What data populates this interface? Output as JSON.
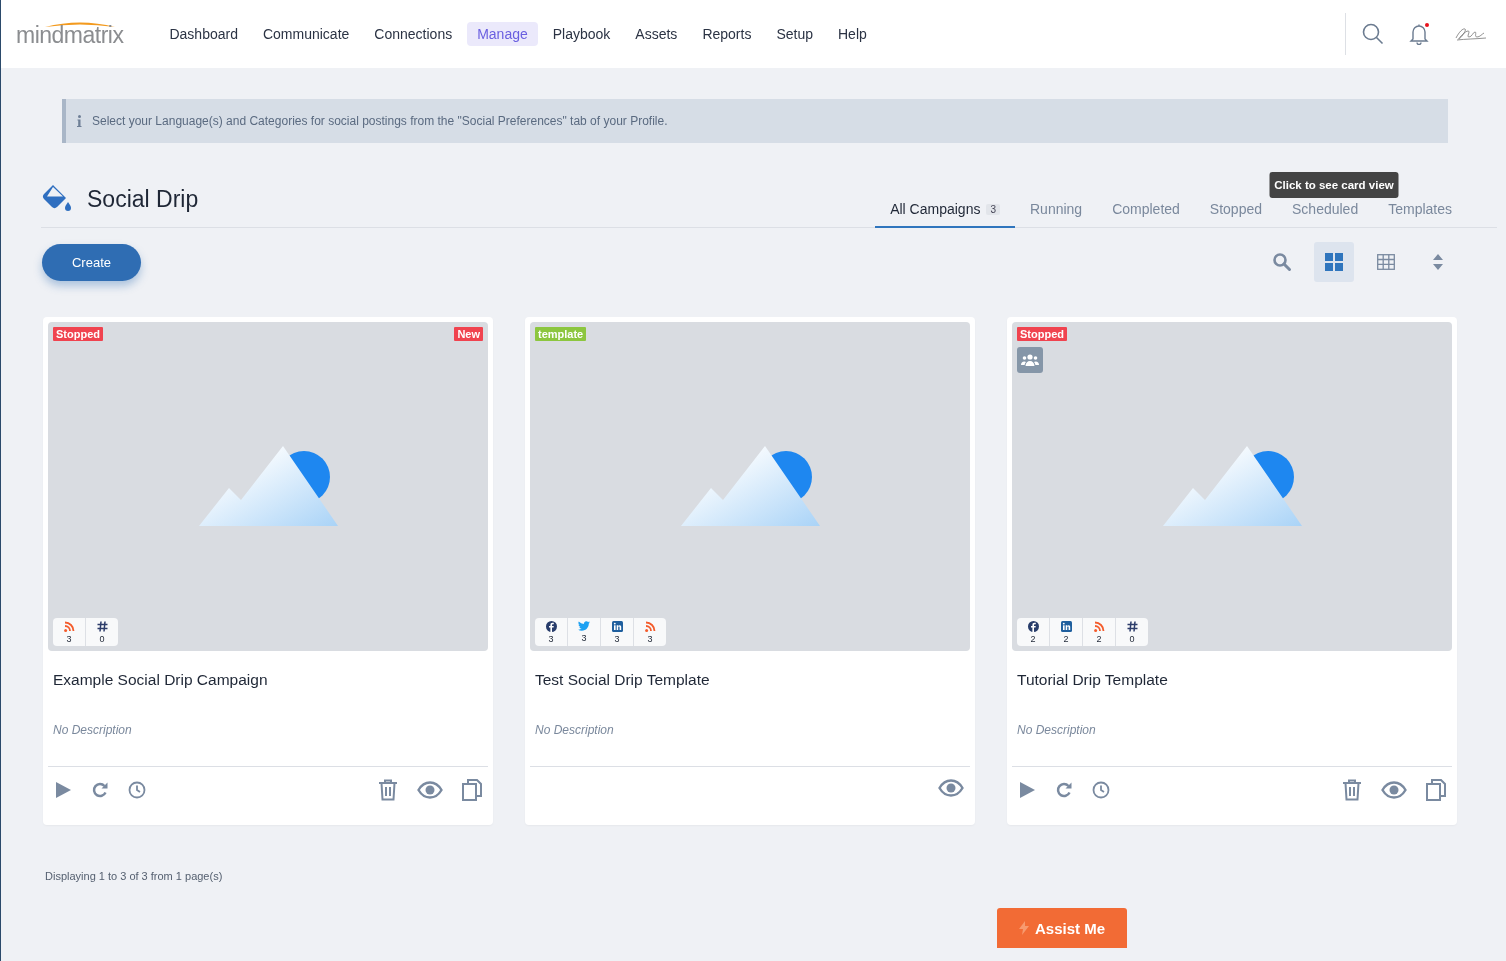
{
  "header": {
    "logo": "mindmatrix",
    "nav": [
      {
        "label": "Dashboard",
        "selected": false
      },
      {
        "label": "Communicate",
        "selected": false
      },
      {
        "label": "Connections",
        "selected": false
      },
      {
        "label": "Manage",
        "selected": true
      },
      {
        "label": "Playbook",
        "selected": false
      },
      {
        "label": "Assets",
        "selected": false
      },
      {
        "label": "Reports",
        "selected": false
      },
      {
        "label": "Setup",
        "selected": false
      },
      {
        "label": "Help",
        "selected": false
      }
    ],
    "notification_dot": true
  },
  "info_banner": "Select your Language(s) and Categories for social postings from the \"Social Preferences\" tab of your Profile.",
  "page_title": "Social Drip",
  "tabs": [
    {
      "label": "All Campaigns",
      "count": "3",
      "selected": true
    },
    {
      "label": "Running",
      "selected": false
    },
    {
      "label": "Completed",
      "selected": false
    },
    {
      "label": "Stopped",
      "selected": false
    },
    {
      "label": "Scheduled",
      "selected": false
    },
    {
      "label": "Templates",
      "selected": false
    }
  ],
  "create_button": "Create",
  "view_tools": [
    {
      "kind": "search",
      "selected": false
    },
    {
      "kind": "grid",
      "selected": true
    },
    {
      "kind": "table",
      "selected": false
    },
    {
      "kind": "sort",
      "selected": false
    }
  ],
  "tooltip": "Click to see card view",
  "cards": [
    {
      "badges": [
        {
          "label": "Stopped",
          "kind": "status",
          "color": "#f0434f"
        },
        {
          "label": "New",
          "kind": "flag",
          "color": "#f0434f"
        }
      ],
      "shared": false,
      "stats": [
        {
          "kind": "rss",
          "count": "3"
        },
        {
          "kind": "hashtag",
          "count": "0"
        }
      ],
      "title": "Example Social Drip Campaign",
      "description": "No Description",
      "actions": [
        {
          "kind": "play"
        },
        {
          "kind": "redo"
        },
        {
          "kind": "clock"
        },
        {
          "kind": "trash"
        },
        {
          "kind": "view"
        },
        {
          "kind": "copy"
        }
      ]
    },
    {
      "badges": [
        {
          "label": "template",
          "kind": "status",
          "color": "#8cc63f"
        }
      ],
      "shared": false,
      "stats": [
        {
          "kind": "facebook",
          "count": "3"
        },
        {
          "kind": "twitter",
          "count": "3"
        },
        {
          "kind": "linkedin",
          "count": "3"
        },
        {
          "kind": "rss",
          "count": "3"
        }
      ],
      "title": "Test Social Drip Template",
      "description": "No Description",
      "actions": [
        {
          "kind": "view"
        }
      ]
    },
    {
      "badges": [
        {
          "label": "Stopped",
          "kind": "status",
          "color": "#f0434f"
        }
      ],
      "shared": true,
      "stats": [
        {
          "kind": "facebook",
          "count": "2"
        },
        {
          "kind": "linkedin",
          "count": "2"
        },
        {
          "kind": "rss",
          "count": "2"
        },
        {
          "kind": "hashtag",
          "count": "0"
        }
      ],
      "title": "Tutorial Drip Template",
      "description": "No Description",
      "actions": [
        {
          "kind": "play"
        },
        {
          "kind": "redo"
        },
        {
          "kind": "clock"
        },
        {
          "kind": "trash"
        },
        {
          "kind": "view"
        },
        {
          "kind": "copy"
        }
      ]
    }
  ],
  "footer": "Displaying 1 to 3 of 3 from 1 page(s)",
  "assist_button": "Assist Me"
}
